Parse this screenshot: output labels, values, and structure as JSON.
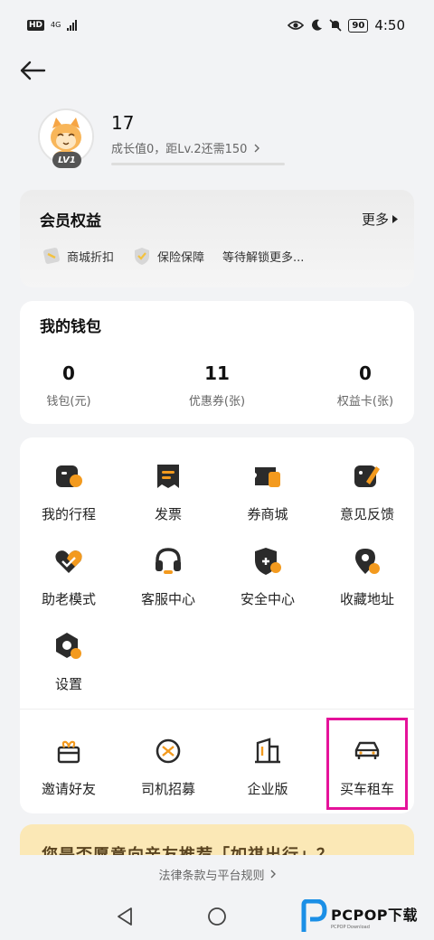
{
  "status_bar": {
    "hd": "HD",
    "network": "4G",
    "battery": "90",
    "time": "4:50"
  },
  "profile": {
    "name": "17",
    "level": "LV1",
    "growth_text": "成长值0，距Lv.2还需150"
  },
  "benefits": {
    "title": "会员权益",
    "more": "更多",
    "items": [
      "商城折扣",
      "保险保障",
      "等待解锁更多..."
    ]
  },
  "wallet": {
    "title": "我的钱包",
    "items": [
      {
        "value": "0",
        "label": "钱包(元)"
      },
      {
        "value": "11",
        "label": "优惠券(张)"
      },
      {
        "value": "0",
        "label": "权益卡(张)"
      }
    ]
  },
  "services": {
    "grid": [
      {
        "label": "我的行程",
        "icon": "trip-icon"
      },
      {
        "label": "发票",
        "icon": "invoice-icon"
      },
      {
        "label": "券商城",
        "icon": "coupon-mall-icon"
      },
      {
        "label": "意见反馈",
        "icon": "feedback-icon"
      },
      {
        "label": "助老模式",
        "icon": "elder-mode-icon"
      },
      {
        "label": "客服中心",
        "icon": "headset-icon"
      },
      {
        "label": "安全中心",
        "icon": "shield-icon"
      },
      {
        "label": "收藏地址",
        "icon": "location-pin-icon"
      },
      {
        "label": "设置",
        "icon": "gear-icon"
      }
    ],
    "bottom": [
      {
        "label": "邀请好友",
        "icon": "gift-icon"
      },
      {
        "label": "司机招募",
        "icon": "steering-wheel-icon"
      },
      {
        "label": "企业版",
        "icon": "building-icon"
      },
      {
        "label": "买车租车",
        "icon": "car-icon"
      }
    ]
  },
  "promo": {
    "text": "您是否愿意向亲友推荐「如祺出行」？"
  },
  "footer": {
    "legal": "法律条款与平台规则"
  },
  "watermark": {
    "text": "PCPOP下载",
    "sub": "PCPOP Download"
  },
  "colors": {
    "accent": "#f39a1e",
    "icon_dark": "#2b2b2b",
    "highlight": "#e5129a"
  }
}
